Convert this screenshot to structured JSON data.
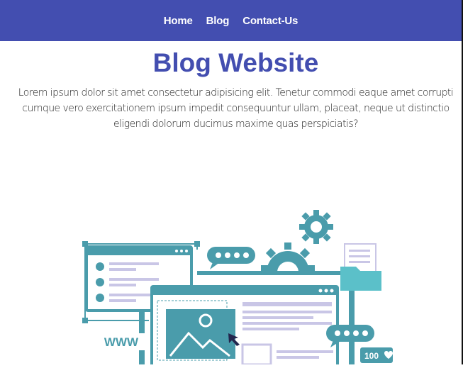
{
  "nav": {
    "items": [
      {
        "label": "Home"
      },
      {
        "label": "Blog"
      },
      {
        "label": "Contact-Us"
      }
    ]
  },
  "header": {
    "title": "Blog Website"
  },
  "intro": {
    "text": "Lorem ipsum dolor sit amet consectetur adipisicing elit. Tenetur commodi eaque amet corrupti cumque vero exercitationem ipsum impedit consequuntur ullam, placeat, neque ut distinctio eligendi dolorum ducimus maxime quas perspiciatis?"
  },
  "hero": {
    "www_label": "WWW",
    "likes_label": "100",
    "colors": {
      "teal": "#4a9cab",
      "light_teal": "#5bc0c9",
      "lavender": "#c9c6e6",
      "navy": "#23264d",
      "bg": "#ffffff"
    }
  },
  "colors": {
    "brand": "#434eb0",
    "text": "#222222"
  }
}
